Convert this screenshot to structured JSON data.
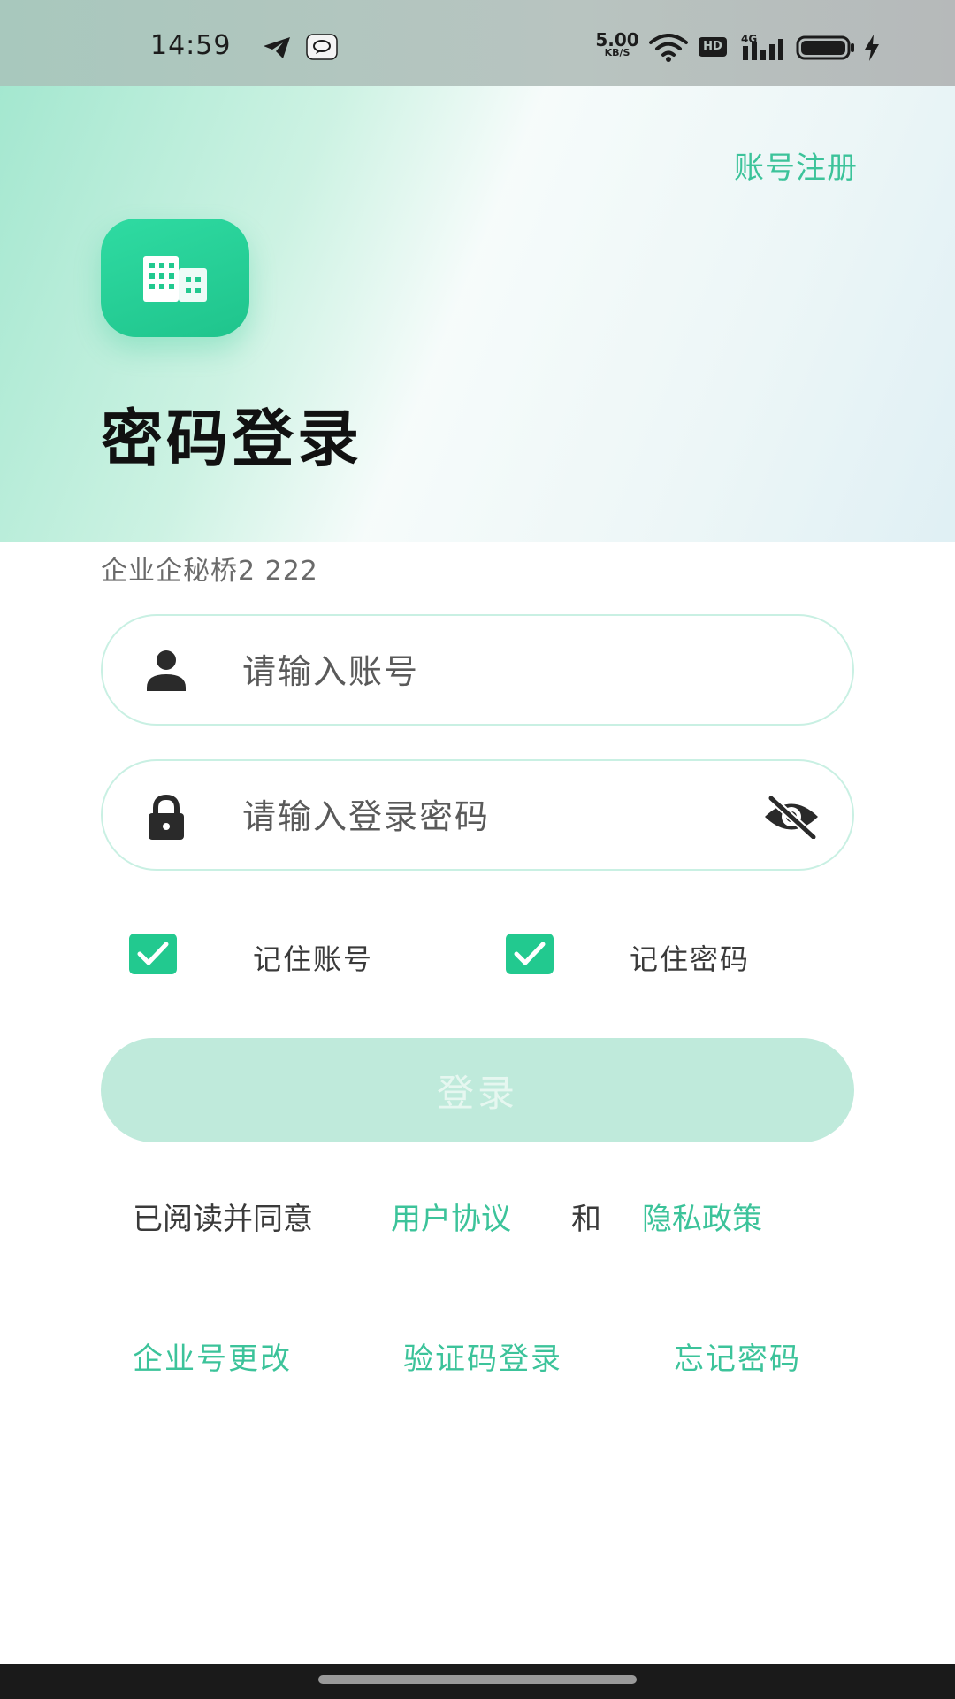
{
  "status_bar": {
    "time": "14:59",
    "net_speed_value": "5.00",
    "net_speed_unit": "KB/S",
    "hd_label": "HD",
    "icons": [
      "telegram-icon",
      "message-bubble-icon",
      "wifi-icon",
      "signal-4g-icon",
      "battery-icon",
      "charging-bolt-icon"
    ]
  },
  "header": {
    "register_link": "账号注册",
    "logo_icon": "building-icon",
    "title": "密码登录"
  },
  "company": {
    "label": "企业企秘桥2  222"
  },
  "form": {
    "account_placeholder": "请输入账号",
    "account_value": "",
    "password_placeholder": "请输入登录密码",
    "password_value": "",
    "remember_account_label": "记住账号",
    "remember_account_checked": true,
    "remember_password_label": "记住密码",
    "remember_password_checked": true,
    "login_button": "登录",
    "login_enabled": false
  },
  "agreement": {
    "prefix": "已阅读并同意",
    "user_agreement": "用户协议",
    "and": "和",
    "privacy_policy": "隐私政策"
  },
  "links": {
    "change_company": "企业号更改",
    "sms_login": "验证码登录",
    "forgot_password": "忘记密码"
  },
  "colors": {
    "accent": "#3cc39a",
    "checkbox": "#22c98f",
    "login_button_disabled": "#bfeadb",
    "field_border": "#c9f0e3"
  }
}
